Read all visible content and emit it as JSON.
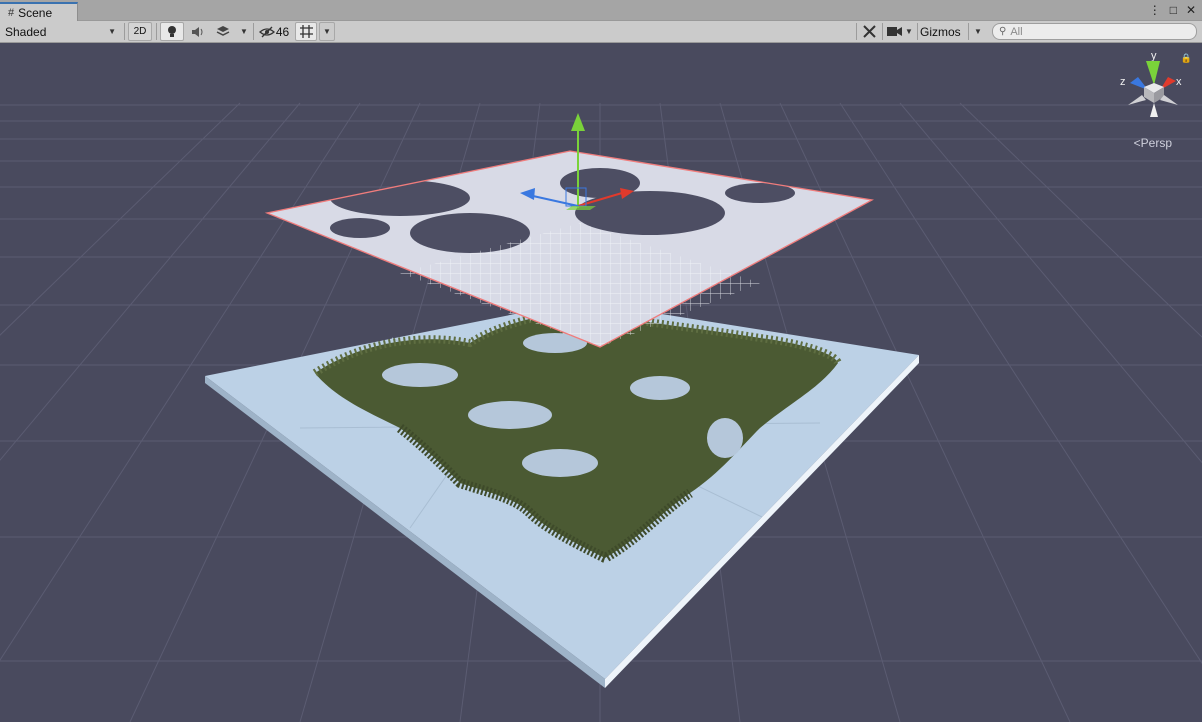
{
  "window": {
    "tab_icon": "#",
    "tab_label": "Scene",
    "controls": [
      "⋮",
      "□",
      "✕"
    ]
  },
  "toolbar": {
    "shading_mode": "Shaded",
    "btn_2d": "2D",
    "hidden_count": "46",
    "gizmos_label": "Gizmos",
    "search_placeholder": "All"
  },
  "viewport": {
    "projection_label": "Persp",
    "axis_labels": {
      "y": "y",
      "x": "x",
      "z": "z"
    },
    "colors": {
      "background": "#494a5e",
      "grid": "#5a5b70",
      "ground_plane": "#bcd1e6",
      "grass": "#4b5a33",
      "selection_outline": "#f07c7c",
      "axis_x": "#e03a2c",
      "axis_y": "#7ad23a",
      "axis_z": "#3a78e0"
    }
  }
}
